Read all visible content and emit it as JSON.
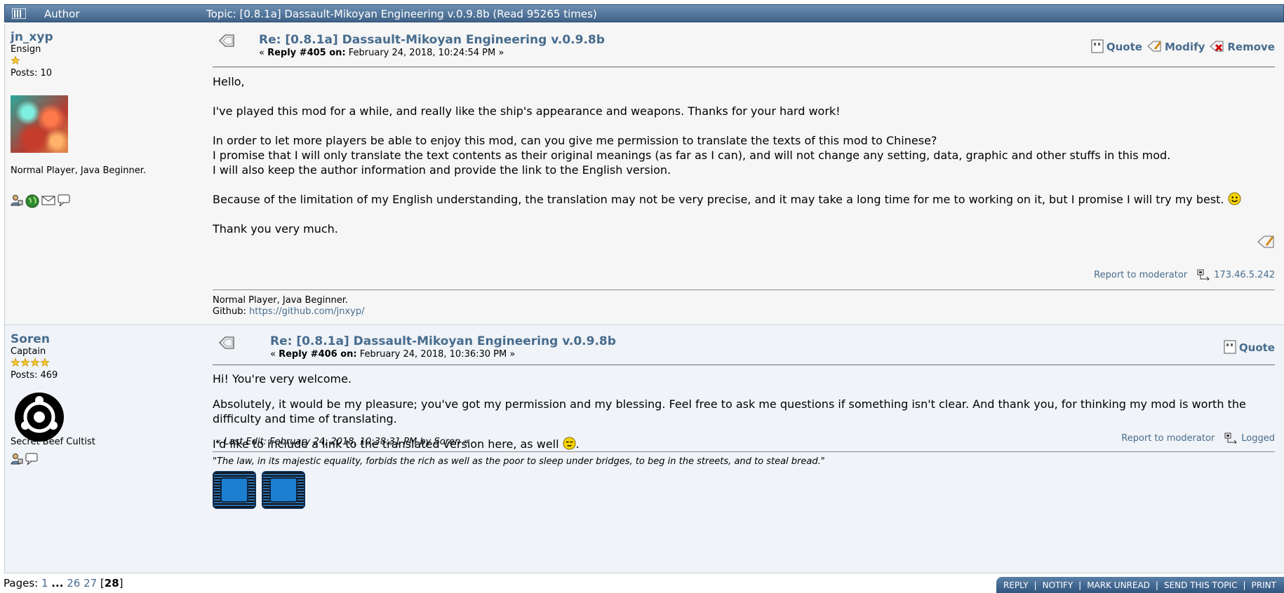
{
  "header": {
    "author_label": "Author",
    "topic_label": "Topic: [0.8.1a] Dassault-Mikoyan Engineering v.0.9.8b  (Read 95265 times)"
  },
  "posts": [
    {
      "username": "jn_xyp",
      "rank": "Ensign",
      "stars": 1,
      "posts_count": "Posts: 10",
      "personal_text": "Normal Player, Java Beginner.",
      "subject": "Re: [0.8.1a] Dassault-Mikoyan Engineering v.0.9.8b",
      "reply_label": "Reply #405 on:",
      "reply_date": "February 24, 2018, 10:24:54 PM",
      "quote_label": "Quote",
      "modify_label": "Modify",
      "remove_label": "Remove",
      "body": [
        "Hello,",
        "I've played this mod for a while, and really like the ship's appearance and weapons. Thanks for your hard work!",
        "In order to let more players be able to enjoy this mod, can you give me permission to translate the texts of this mod to Chinese?",
        "I promise that I will only translate the text contents as their original meanings (as far as I can), and will not change any setting, data, graphic and other stuffs in this mod.",
        "I will also keep the author information and provide the link to the English version.",
        "Because of the limitation of my English understanding, the translation may not be very precise, and it may take a long time for me to working on it, but I promise I will try my best.",
        "Thank you very much."
      ],
      "report_label": "Report to moderator",
      "ip": "173.46.5.242",
      "signature_line1": "Normal Player, Java Beginner.",
      "signature_github_label": "Github:",
      "signature_github_url": "https://github.com/jnxyp/"
    },
    {
      "username": "Soren",
      "rank": "Captain",
      "stars": 4,
      "posts_count": "Posts: 469",
      "personal_text": "Secret Beef Cultist",
      "subject": "Re: [0.8.1a] Dassault-Mikoyan Engineering v.0.9.8b",
      "reply_label": "Reply #406 on:",
      "reply_date": "February 24, 2018, 10:36:30 PM",
      "quote_label": "Quote",
      "body": [
        "Hi! You're very welcome.",
        "Absolutely, it would be my pleasure; you've got my permission and my blessing. Feel free to ask me questions if something isn't clear. And thank you, for thinking my mod is worth the difficulty and time of translating.",
        "I'd like to include a link to the translated version here, as well"
      ],
      "last_edit": "« Last Edit: February 24, 2018, 10:38:31 PM by Soren »",
      "report_label": "Report to moderator",
      "logged_label": "Logged",
      "signature_quote": "\"The law, in its majestic equality, forbids the rich as well as the poor to sleep under bridges, to beg in the streets, and to steal bread.\""
    }
  ],
  "pagination": {
    "label": "Pages:",
    "first": "1",
    "ellipsis": "...",
    "p26": "26",
    "p27": "27",
    "current": "28"
  },
  "buttons": {
    "reply": "REPLY",
    "notify": "NOTIFY",
    "mark_unread": "MARK UNREAD",
    "send_topic": "SEND THIS TOPIC",
    "print": "PRINT"
  },
  "colors": {
    "link": "#476c8e",
    "header_top": "#6d90b3",
    "header_bottom": "#3f6288",
    "post_bg_1": "#f6f6f6",
    "post_bg_2": "#f0f3f7"
  }
}
